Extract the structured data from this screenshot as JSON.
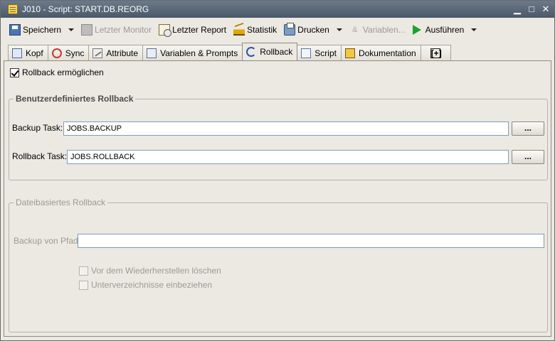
{
  "window": {
    "title": "J010 - Script: START.DB.REORG"
  },
  "toolbar": {
    "save_label": "Speichern",
    "monitor_label": "Letzter Monitor",
    "report_label": "Letzter Report",
    "stats_label": "Statistik",
    "print_label": "Drucken",
    "vars_label": "Variablen...",
    "run_label": "Ausführen"
  },
  "tabs": [
    {
      "label": "Kopf"
    },
    {
      "label": "Sync"
    },
    {
      "label": "Attribute"
    },
    {
      "label": "Variablen & Prompts"
    },
    {
      "label": "Rollback"
    },
    {
      "label": "Script"
    },
    {
      "label": "Dokumentation"
    },
    {
      "label": "[+]"
    }
  ],
  "rollback": {
    "enable_label": "Rollback ermöglichen",
    "enabled": true,
    "custom_group_title": "Benutzerdefiniertes Rollback",
    "backup_task_label": "Backup Task:",
    "backup_task_value": "JOBS.BACKUP",
    "rollback_task_label": "Rollback Task:",
    "rollback_task_value": "JOBS.ROLLBACK",
    "browse_label": "...",
    "file_group_title": "Dateibasiertes Rollback",
    "backup_path_label": "Backup von Pfad:",
    "backup_path_value": "",
    "restore_delete_label": "Vor dem Wiederherstellen löschen",
    "subdirs_label": "Unterverzeichnisse einbeziehen"
  }
}
